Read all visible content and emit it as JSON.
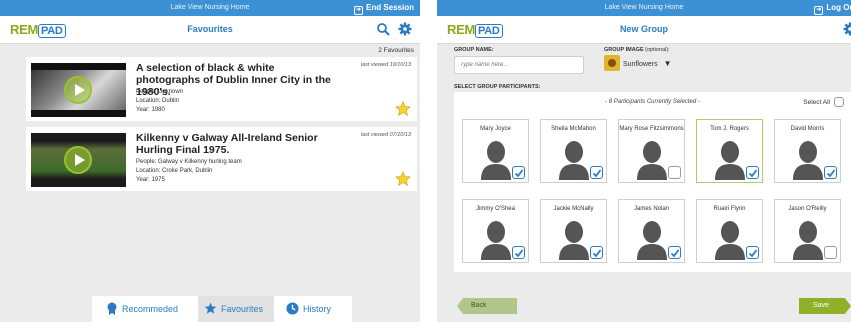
{
  "left": {
    "status_title": "Lake View Nursing Home",
    "end_session": "End Session",
    "logo_rem": "REM",
    "logo_pad": "PAD",
    "nav_title": "Favourites",
    "fav_count": "2 Favourites",
    "items": [
      {
        "title": "A selection of black & white photographs of Dublin Inner City in the 1980's.",
        "last_viewed": "last viewed 19/10/13",
        "people": "People: Unknown",
        "location": "Location: Dublin",
        "year": "Year: 1980"
      },
      {
        "title": "Kilkenny v Galway All-Ireland Senior Hurling Final 1975.",
        "last_viewed": "last viewed 07/10/13",
        "people": "People: Galway v Kilkenny hurling team",
        "location": "Location: Croke Park, Dublin",
        "year": "Year: 1975"
      }
    ],
    "tabs": [
      {
        "label": "Recommeded",
        "icon": "ribbon-icon"
      },
      {
        "label": "Favourites",
        "icon": "star-icon"
      },
      {
        "label": "History",
        "icon": "clock-icon"
      }
    ],
    "active_tab": "Favourites"
  },
  "right": {
    "status_title": "Lake View Nursing Home",
    "log_out": "Log Out",
    "logo_rem": "REM",
    "logo_pad": "PAD",
    "nav_title": "New Group",
    "group_name_label": "GROUP NAME:",
    "group_name_placeholder": "Type name here...",
    "group_image_label": "GROUP IMAGE",
    "group_image_optional": "(optional):",
    "group_image_value": "Sunflowers",
    "participants_label": "SELECT GROUP PARTICIPANTS:",
    "selected_text": "- 8 Participants Currently Selected -",
    "select_all": "Select All",
    "participants": [
      {
        "name": "Mary Joyce",
        "selected": true
      },
      {
        "name": "Sheila McMahon",
        "selected": true
      },
      {
        "name": "Mary Rose Fitzsimmons",
        "selected": false
      },
      {
        "name": "Tom J. Rogers",
        "selected": true
      },
      {
        "name": "David Morris",
        "selected": true
      },
      {
        "name": "Jimmy O'Shea",
        "selected": true
      },
      {
        "name": "Jackie McNally",
        "selected": true
      },
      {
        "name": "James Nolan",
        "selected": true
      },
      {
        "name": "Ruairi Flynn",
        "selected": true
      },
      {
        "name": "Jason O'Reilly",
        "selected": false
      }
    ],
    "back_label": "Back",
    "save_label": "Save"
  },
  "colors": {
    "status_blue": "#3c91d4",
    "brand_blue": "#2a7bc4",
    "brand_green": "#8aaa1c",
    "star_yellow": "#f4d42a"
  }
}
